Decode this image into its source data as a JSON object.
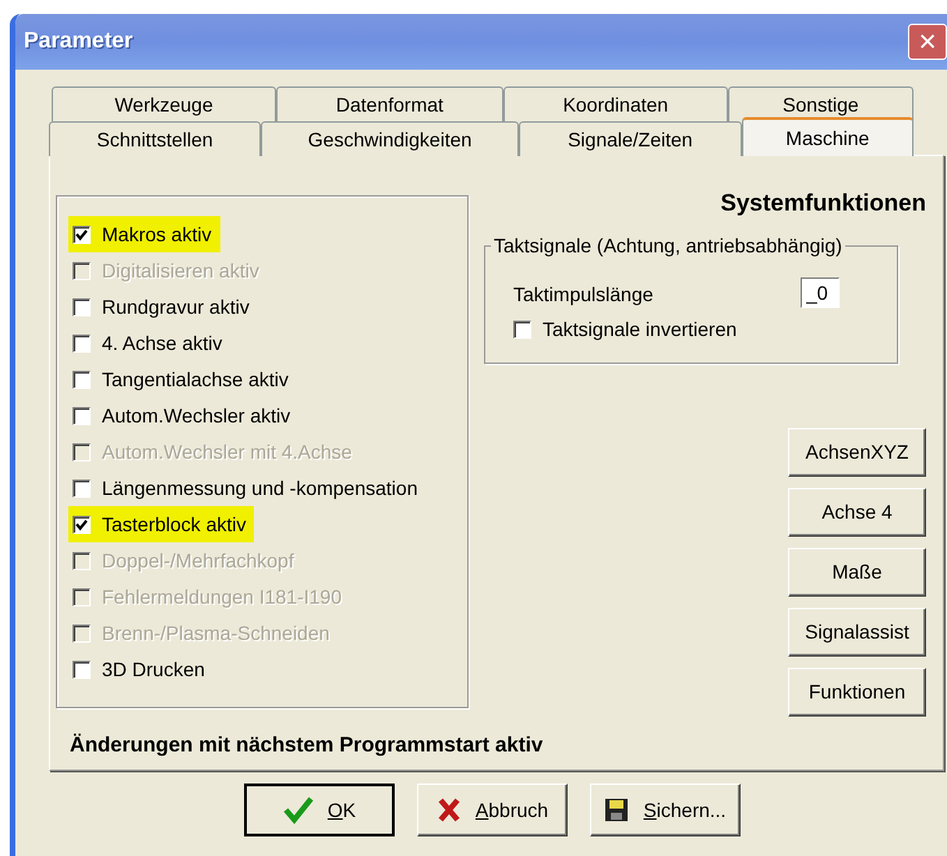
{
  "window": {
    "title": "Parameter",
    "close": "×"
  },
  "tabs_back": [
    {
      "label": "Werkzeuge",
      "selected": false
    },
    {
      "label": "Datenformat",
      "selected": false
    },
    {
      "label": "Koordinaten",
      "selected": false
    },
    {
      "label": "Sonstige",
      "selected": false
    }
  ],
  "tabs_front": [
    {
      "label": "Schnittstellen",
      "selected": false
    },
    {
      "label": "Geschwindigkeiten",
      "selected": false
    },
    {
      "label": "Signale/Zeiten",
      "selected": false
    },
    {
      "label": "Maschine",
      "selected": true
    }
  ],
  "options": [
    {
      "label": "Makros aktiv",
      "checked": true,
      "disabled": false,
      "highlighted": true
    },
    {
      "label": "Digitalisieren aktiv",
      "checked": false,
      "disabled": true,
      "highlighted": false
    },
    {
      "label": "Rundgravur aktiv",
      "checked": false,
      "disabled": false,
      "highlighted": false
    },
    {
      "label": "4. Achse aktiv",
      "checked": false,
      "disabled": false,
      "highlighted": false
    },
    {
      "label": "Tangentialachse aktiv",
      "checked": false,
      "disabled": false,
      "highlighted": false
    },
    {
      "label": "Autom.Wechsler aktiv",
      "checked": false,
      "disabled": false,
      "highlighted": false
    },
    {
      "label": "Autom.Wechsler mit 4.Achse",
      "checked": false,
      "disabled": true,
      "highlighted": false
    },
    {
      "label": "Längenmessung und -kompensation",
      "checked": false,
      "disabled": false,
      "highlighted": false
    },
    {
      "label": "Tasterblock aktiv",
      "checked": true,
      "disabled": false,
      "highlighted": true
    },
    {
      "label": "Doppel-/Mehrfachkopf",
      "checked": false,
      "disabled": true,
      "highlighted": false
    },
    {
      "label": "Fehlermeldungen I181-I190",
      "checked": false,
      "disabled": true,
      "highlighted": false
    },
    {
      "label": "Brenn-/Plasma-Schneiden",
      "checked": false,
      "disabled": true,
      "highlighted": false
    },
    {
      "label": "3D Drucken",
      "checked": false,
      "disabled": false,
      "highlighted": false
    }
  ],
  "heading": "Systemfunktionen",
  "taktsignale": {
    "legend": "Taktsignale (Achtung, antriebsabhängig)",
    "pulse_label": "Taktimpulslänge",
    "pulse_value": "_0",
    "invert": {
      "label": "Taktsignale invertieren",
      "checked": false
    }
  },
  "side_buttons": [
    "AchsenXYZ",
    "Achse 4",
    "Maße",
    "Signalassist",
    "Funktionen"
  ],
  "note": "Änderungen mit nächstem Programmstart aktiv",
  "buttons": [
    {
      "kind": "ok",
      "label": "OK",
      "default": true
    },
    {
      "kind": "cancel",
      "label": "Abbruch",
      "default": false
    },
    {
      "kind": "save",
      "label": "Sichern...",
      "default": false
    }
  ]
}
